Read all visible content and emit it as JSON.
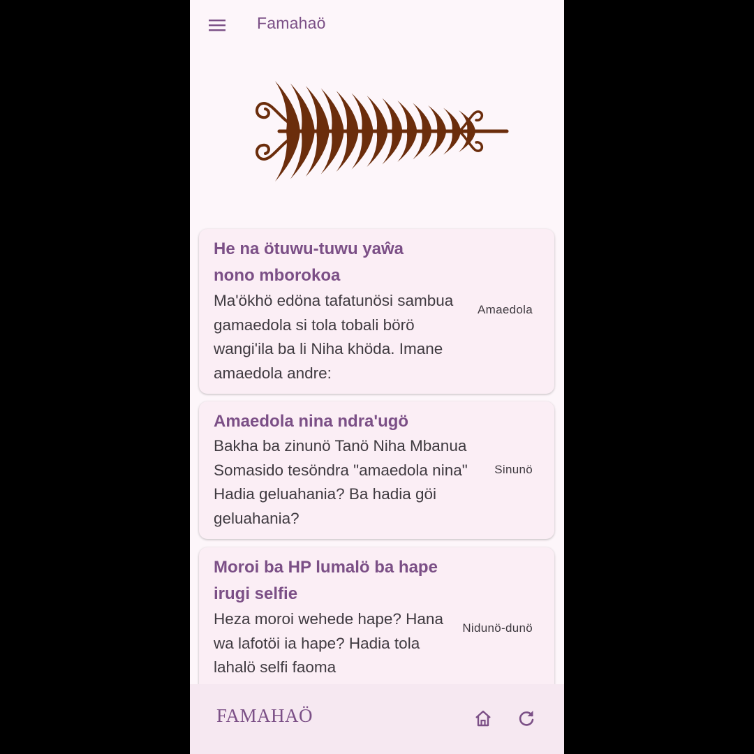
{
  "appbar": {
    "title": "Famahaö",
    "menu_icon": "menu-icon"
  },
  "logo": {
    "icon": "fern-ornament-logo",
    "color": "#6b2d0c"
  },
  "articles": [
    {
      "title": "He na ötuwu-tuwu yaŵa nono mborokoa",
      "excerpt": "Ma'ökhö edöna tafatunösi sambua gamaedola si tola tobali börö wangi'ila ba li Niha khöda. Imane amaedola andre:",
      "category": "Amaedola"
    },
    {
      "title": "Amaedola nina ndra'ugö",
      "excerpt": "Bakha ba zinunö Tanö Niha Mbanua Somasido tesöndra \"amaedola nina\" Hadia geluahania? Ba hadia göi geluahania?",
      "category": "Sinunö"
    },
    {
      "title": "Moroi ba HP lumalö ba hape irugi selfie",
      "excerpt": "Heza moroi wehede hape? Hana wa lafotöi ia hape? Hadia tola lahalö selfi faoma",
      "category": "Nidunö-dunö"
    }
  ],
  "bottombar": {
    "brand": "FAMAHAÖ",
    "home_icon": "home-icon",
    "refresh_icon": "refresh-icon"
  },
  "colors": {
    "accent": "#7b4f86",
    "background": "#fdf6fa",
    "card": "#fbeef5",
    "bottom_bar": "#f6e8f1"
  }
}
